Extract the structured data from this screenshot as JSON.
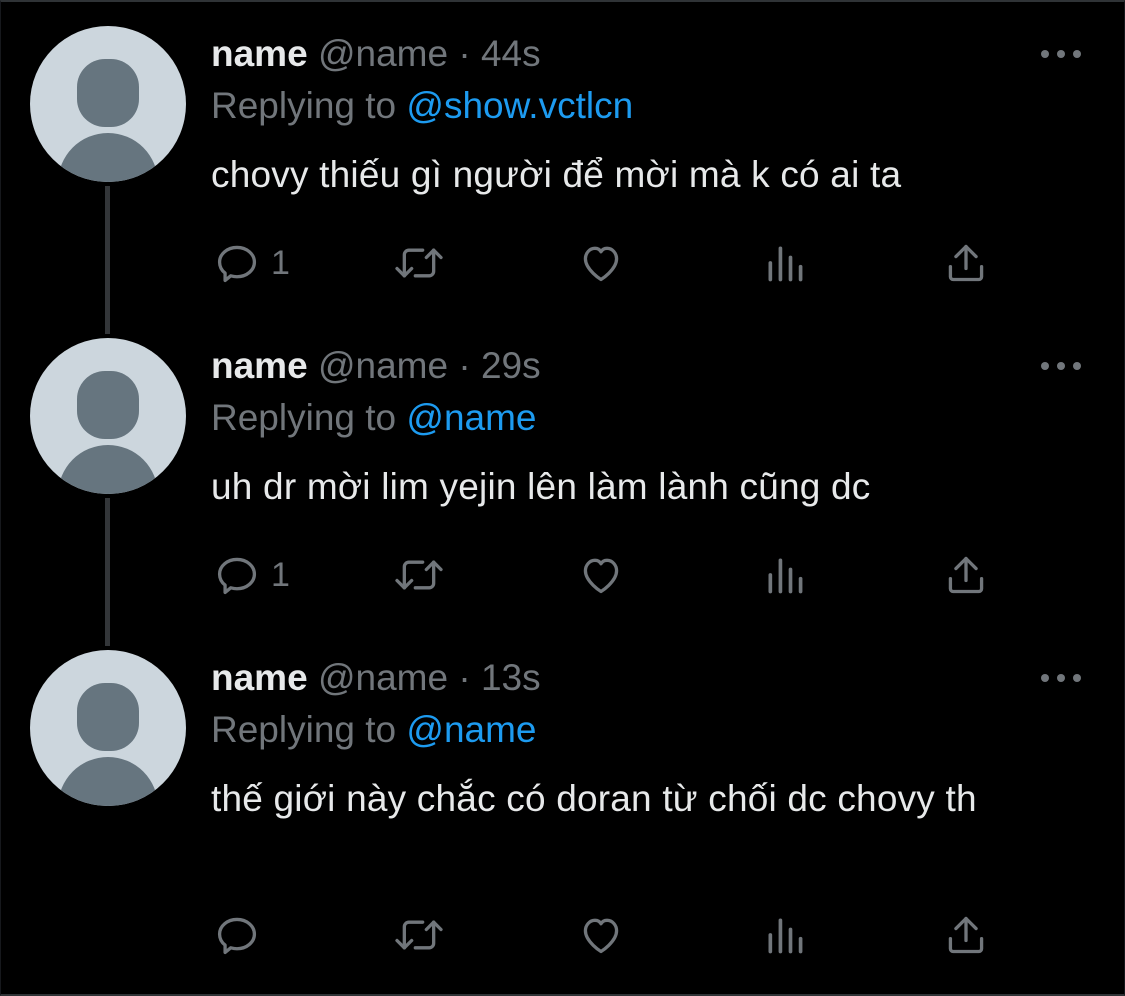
{
  "colors": {
    "background": "#000000",
    "primary_text": "#e7e9ea",
    "secondary_text": "#71767b",
    "link": "#1d9bf0",
    "avatar_bg": "#ccd6dd",
    "avatar_fg": "#66757f",
    "thread_line": "#333639"
  },
  "tweets": [
    {
      "display_name": "name",
      "handle": "@name",
      "separator": "·",
      "time": "44s",
      "replying_prefix": "Replying to ",
      "replying_to": "@show.vctlcn",
      "text": "chovy thiếu gì người để mời mà k có ai ta",
      "reply_count": "1",
      "icons": [
        "reply-icon",
        "retweet-icon",
        "like-icon",
        "views-icon",
        "share-icon",
        "more-icon"
      ]
    },
    {
      "display_name": "name",
      "handle": "@name",
      "separator": "·",
      "time": "29s",
      "replying_prefix": "Replying to ",
      "replying_to": "@name",
      "text": "uh dr mời lim yejin lên làm lành cũng dc",
      "reply_count": "1",
      "icons": [
        "reply-icon",
        "retweet-icon",
        "like-icon",
        "views-icon",
        "share-icon",
        "more-icon"
      ]
    },
    {
      "display_name": "name",
      "handle": "@name",
      "separator": "·",
      "time": "13s",
      "replying_prefix": "Replying to ",
      "replying_to": "@name",
      "text": "thế giới này chắc có doran từ chối dc chovy th",
      "reply_count": "",
      "icons": [
        "reply-icon",
        "retweet-icon",
        "like-icon",
        "views-icon",
        "share-icon",
        "more-icon"
      ]
    }
  ]
}
